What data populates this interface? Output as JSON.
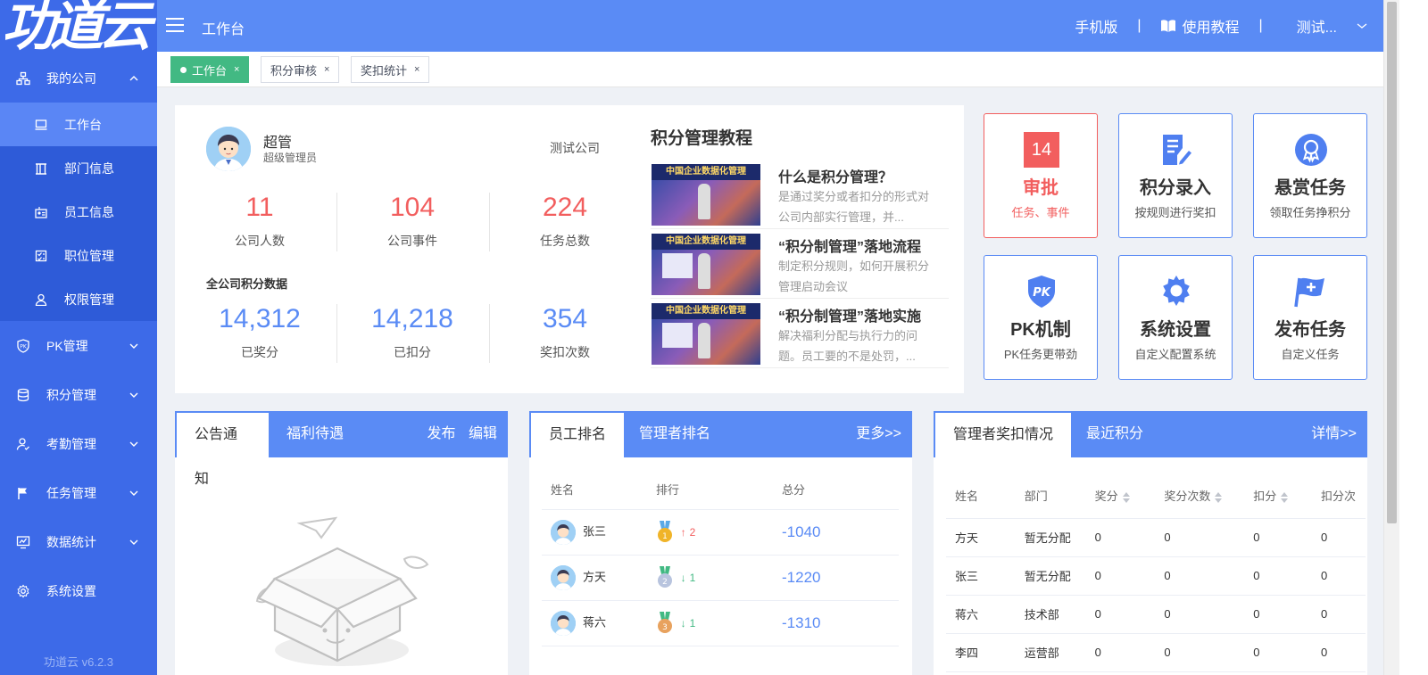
{
  "brand": {
    "logo_text": "功道云",
    "version": "功道云 v6.2.3"
  },
  "sidebar": {
    "groups": [
      {
        "label": "我的公司",
        "icon": "org-icon",
        "expanded": true,
        "children": [
          {
            "label": "工作台",
            "icon": "monitor-icon",
            "active": true
          },
          {
            "label": "部门信息",
            "icon": "building-icon"
          },
          {
            "label": "员工信息",
            "icon": "id-card-icon"
          },
          {
            "label": "职位管理",
            "icon": "checklist-icon"
          },
          {
            "label": "权限管理",
            "icon": "user-icon"
          }
        ]
      },
      {
        "label": "PK管理",
        "icon": "shield-icon"
      },
      {
        "label": "积分管理",
        "icon": "database-icon"
      },
      {
        "label": "考勤管理",
        "icon": "person-check-icon"
      },
      {
        "label": "任务管理",
        "icon": "flag-icon"
      },
      {
        "label": "数据统计",
        "icon": "chart-icon"
      },
      {
        "label": "系统设置",
        "icon": "gear-icon"
      }
    ]
  },
  "header": {
    "title": "工作台",
    "mobile": "手机版",
    "separator": "|",
    "guide": "使用教程",
    "user": "测试..."
  },
  "tabs": [
    {
      "label": "工作台",
      "active": true,
      "close": "×"
    },
    {
      "label": "积分审核",
      "active": false,
      "close": "×"
    },
    {
      "label": "奖扣统计",
      "active": false,
      "close": "×"
    }
  ],
  "profile": {
    "name": "超管",
    "role": "超级管理员",
    "company": "测试公司",
    "stats_top": [
      {
        "value": "11",
        "label": "公司人数"
      },
      {
        "value": "104",
        "label": "公司事件"
      },
      {
        "value": "224",
        "label": "任务总数"
      }
    ],
    "points_title": "全公司积分数据",
    "stats_bottom": [
      {
        "value": "14,312",
        "label": "已奖分"
      },
      {
        "value": "14,218",
        "label": "已扣分"
      },
      {
        "value": "354",
        "label": "奖扣次数"
      }
    ]
  },
  "tutorials": {
    "title": "积分管理教程",
    "items": [
      {
        "thumb_banner": "中国企业数据化管理",
        "title": "什么是积分管理？",
        "desc": "是通过奖分或者扣分的形式对公司内部实行管理，并..."
      },
      {
        "thumb_banner": "中国企业数据化管理",
        "title": "“积分制管理”落地流程",
        "desc": "制定积分规则，如何开展积分管理启动会议"
      },
      {
        "thumb_banner": "中国企业数据化管理",
        "title": "“积分制管理”落地实施",
        "desc": "解决福利分配与执行力的问题。员工要的不是处罚，..."
      }
    ]
  },
  "tiles": [
    {
      "badge": "14",
      "title": "审批",
      "sub": "任务、事件",
      "icon": "approval-badge",
      "color": "#f25e5e"
    },
    {
      "title": "积分录入",
      "sub": "按规则进行奖扣",
      "icon": "edit-doc-icon"
    },
    {
      "title": "悬赏任务",
      "sub": "领取任务挣积分",
      "icon": "award-icon"
    },
    {
      "title": "PK机制",
      "sub": "PK任务更带劲",
      "icon": "pk-shield-icon"
    },
    {
      "title": "系统设置",
      "sub": "自定义配置系统",
      "icon": "gear-icon"
    },
    {
      "title": "发布任务",
      "sub": "自定义任务",
      "icon": "flag-plus-icon"
    }
  ],
  "notice_panel": {
    "tabs": [
      "公告通知",
      "福利待遇"
    ],
    "publish": "发布",
    "edit": "编辑",
    "empty_illustration": "empty-box-icon"
  },
  "rank_panel": {
    "tabs": [
      "员工排名",
      "管理者排名"
    ],
    "more": "更多>>",
    "columns": [
      "姓名",
      "排行",
      "总分"
    ],
    "rows": [
      {
        "name": "张三",
        "medal": "gold-medal-icon",
        "trend": "up",
        "change": "2",
        "score": "-1040"
      },
      {
        "name": "方天",
        "medal": "silver-medal-icon",
        "trend": "down",
        "change": "1",
        "score": "-1220"
      },
      {
        "name": "蒋六",
        "medal": "bronze-medal-icon",
        "trend": "down",
        "change": "1",
        "score": "-1310"
      }
    ]
  },
  "mgr_panel": {
    "tabs": [
      "管理者奖扣情况",
      "最近积分"
    ],
    "detail": "详情>>",
    "columns": [
      "姓名",
      "部门",
      "奖分",
      "奖分次数",
      "扣分",
      "扣分次"
    ],
    "rows": [
      [
        "方天",
        "暂无分配",
        "0",
        "0",
        "0",
        "0"
      ],
      [
        "张三",
        "暂无分配",
        "0",
        "0",
        "0",
        "0"
      ],
      [
        "蒋六",
        "技术部",
        "0",
        "0",
        "0",
        "0"
      ],
      [
        "李四",
        "运营部",
        "0",
        "0",
        "0",
        "0"
      ]
    ]
  },
  "colors": {
    "primary": "#5a8bf5",
    "sidebar": "#3d6ae8",
    "danger": "#f25e5e",
    "success": "#42b983"
  }
}
